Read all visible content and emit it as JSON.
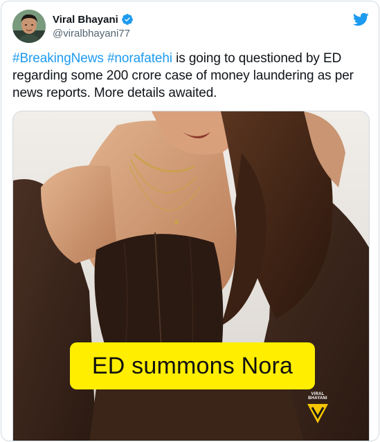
{
  "tweet": {
    "author": {
      "display_name": "Viral Bhayani",
      "handle": "@viralbhayani77",
      "verified": true
    },
    "text_parts": [
      {
        "text": "#BreakingNews",
        "type": "hashtag"
      },
      {
        "text": " ",
        "type": "plain"
      },
      {
        "text": "#norafatehi",
        "type": "hashtag"
      },
      {
        "text": " is going to questioned by ED regarding some 200 crore case of money laundering as per news reports. More details awaited.",
        "type": "plain"
      }
    ],
    "media": {
      "caption": "ED summons  Nora",
      "logo_label": "VIRAL BHAYANI"
    }
  },
  "icons": {
    "verified": "verified-badge-icon",
    "platform": "twitter-bird-icon",
    "media_logo": "vb-logo-icon"
  },
  "colors": {
    "accent": "#1d9bf0",
    "text": "#0f1419",
    "secondary_text": "#536471",
    "caption_bg": "#ffee00",
    "border": "#cfd9de"
  }
}
